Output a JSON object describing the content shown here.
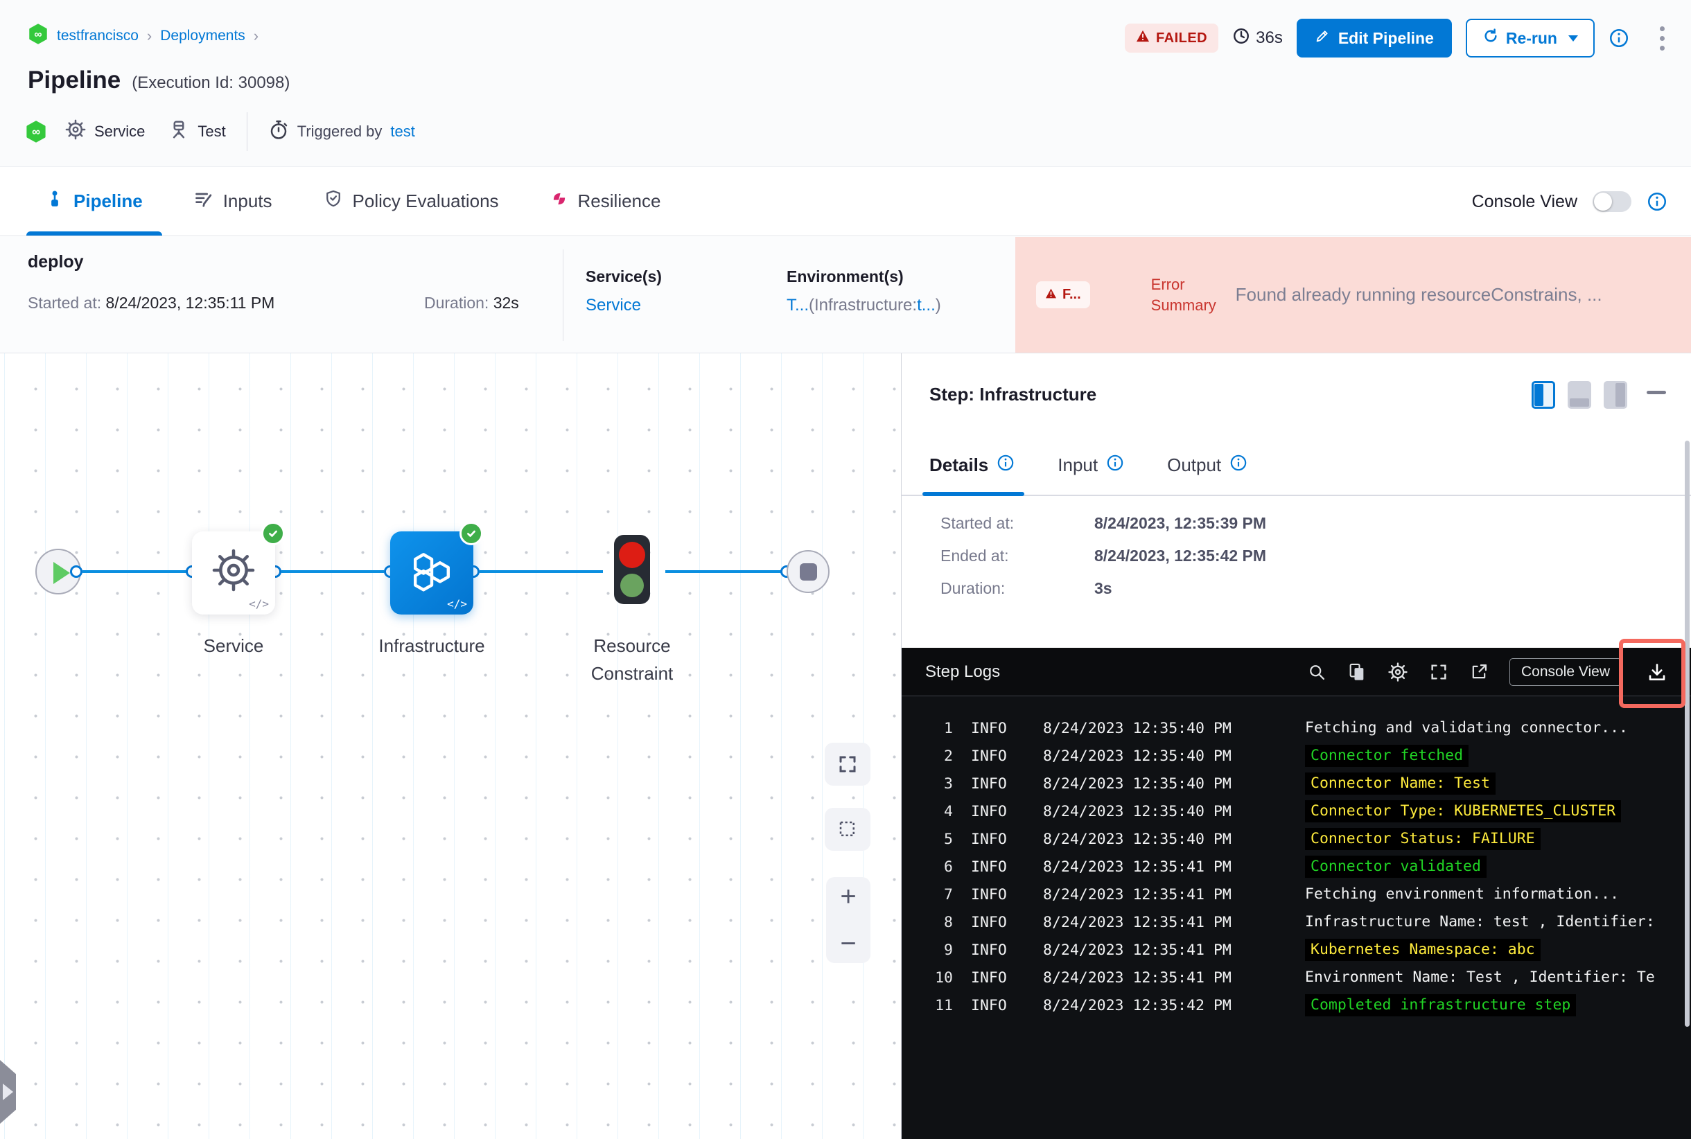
{
  "colors": {
    "accent_blue": "#0278d5",
    "failed_red": "#b41710",
    "error_bg_pink": "#fbdcd7",
    "success_green": "#3fae49",
    "node_blue": "#0b84e0",
    "log_green": "#21d425",
    "log_yellow": "#fdea3c",
    "log_bg": "#0f1114"
  },
  "icons": {
    "chevron": "›",
    "plus": "+",
    "minus": "−",
    "code": "</>",
    "infinity": "∞"
  },
  "breadcrumb": {
    "project": "testfrancisco",
    "section": "Deployments"
  },
  "header": {
    "title": "Pipeline",
    "execution_id": "(Execution Id: 30098)",
    "service_label": "Service",
    "environment_label": "Test",
    "triggered_by_label": "Triggered by",
    "triggered_by_value": "test",
    "status_badge": "FAILED",
    "total_duration": "36s",
    "edit_pipeline_button": "Edit Pipeline",
    "rerun_button": "Re-run"
  },
  "tabs": [
    {
      "label": "Pipeline",
      "active": true
    },
    {
      "label": "Inputs",
      "active": false
    },
    {
      "label": "Policy Evaluations",
      "active": false
    },
    {
      "label": "Resilience",
      "active": false
    }
  ],
  "console_toggle": {
    "label": "Console View",
    "state": "off"
  },
  "summary": {
    "stage_name": "deploy",
    "started_label": "Started at: ",
    "started_value": "8/24/2023, 12:35:11 PM",
    "duration_label": "Duration: ",
    "duration_value": "32s",
    "services_label": "Service(s)",
    "services_value": "Service",
    "environments_label": "Environment(s)",
    "env_link1": "T...",
    "env_mid": "(Infrastructure:",
    "env_link2": "t...",
    "env_end": ")",
    "error_badge": "F...",
    "error_label": "Error Summary",
    "error_text": "Found already running resourceConstrains, ..."
  },
  "graph": {
    "nodes": [
      {
        "label": "Service"
      },
      {
        "label": "Infrastructure"
      },
      {
        "label": "Resource Constraint"
      }
    ]
  },
  "panel": {
    "title": "Step: Infrastructure",
    "tabs": [
      {
        "label": "Details"
      },
      {
        "label": "Input"
      },
      {
        "label": "Output"
      }
    ],
    "fields": [
      {
        "label": "Started at:",
        "value": "8/24/2023, 12:35:39 PM"
      },
      {
        "label": "Ended at:",
        "value": "8/24/2023, 12:35:42 PM"
      },
      {
        "label": "Duration:",
        "value": "3s"
      }
    ]
  },
  "logs": {
    "title": "Step Logs",
    "console_view_button": "Console View",
    "lines": [
      {
        "num": "1",
        "level": "INFO",
        "time": "8/24/2023 12:35:40 PM",
        "msg": "Fetching and validating connector...",
        "color": "white"
      },
      {
        "num": "2",
        "level": "INFO",
        "time": "8/24/2023 12:35:40 PM",
        "msg": "Connector fetched",
        "color": "green"
      },
      {
        "num": "3",
        "level": "INFO",
        "time": "8/24/2023 12:35:40 PM",
        "msg": "Connector Name: Test",
        "color": "yellow"
      },
      {
        "num": "4",
        "level": "INFO",
        "time": "8/24/2023 12:35:40 PM",
        "msg": "Connector Type: KUBERNETES_CLUSTER",
        "color": "yellow"
      },
      {
        "num": "5",
        "level": "INFO",
        "time": "8/24/2023 12:35:40 PM",
        "msg": "Connector Status: FAILURE",
        "color": "yellow"
      },
      {
        "num": "6",
        "level": "INFO",
        "time": "8/24/2023 12:35:41 PM",
        "msg": "Connector validated",
        "color": "green"
      },
      {
        "num": "7",
        "level": "INFO",
        "time": "8/24/2023 12:35:41 PM",
        "msg": "Fetching environment information...",
        "color": "white"
      },
      {
        "num": "8",
        "level": "INFO",
        "time": "8/24/2023 12:35:41 PM",
        "msg": "Infrastructure Name: test , Identifier:",
        "color": "white"
      },
      {
        "num": "9",
        "level": "INFO",
        "time": "8/24/2023 12:35:41 PM",
        "msg": "Kubernetes Namespace: abc",
        "color": "yellow"
      },
      {
        "num": "10",
        "level": "INFO",
        "time": "8/24/2023 12:35:41 PM",
        "msg": "Environment Name: Test , Identifier: Te",
        "color": "white"
      },
      {
        "num": "11",
        "level": "INFO",
        "time": "8/24/2023 12:35:42 PM",
        "msg": "Completed infrastructure step",
        "color": "green"
      }
    ]
  }
}
